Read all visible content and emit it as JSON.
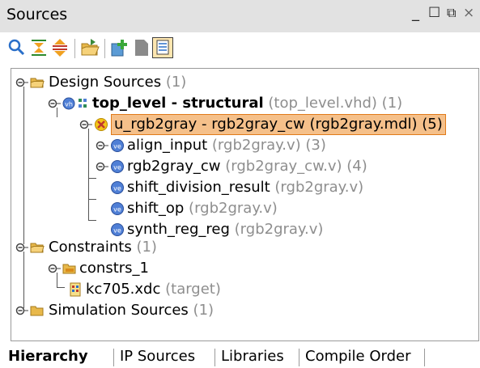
{
  "panel": {
    "title": "Sources"
  },
  "window_controls": {
    "minimize": "_",
    "maximize": "☐",
    "restore": "⧉",
    "close": "×"
  },
  "toolbar": {
    "buttons": [
      "search-icon",
      "collapse-all-icon",
      "expand-all-icon",
      "open-folder-icon",
      "add-sources-icon",
      "file-icon",
      "show-hierarchy-icon"
    ]
  },
  "tree": {
    "design_sources": {
      "label": "Design Sources",
      "count": "(1)"
    },
    "top_level": {
      "label": "top_level - structural",
      "file": "(top_level.vhd)",
      "count": "(1)"
    },
    "u_rgb2gray": {
      "label": "u_rgb2gray - rgb2gray_cw (rgb2gray.mdl) (5)"
    },
    "align_input": {
      "label": "align_input",
      "file": "(rgb2gray.v)",
      "count": "(3)"
    },
    "rgb2gray_cw": {
      "label": "rgb2gray_cw",
      "file": "(rgb2gray_cw.v)",
      "count": "(4)"
    },
    "shift_division_result": {
      "label": "shift_division_result",
      "file": "(rgb2gray.v)"
    },
    "shift_op": {
      "label": "shift_op",
      "file": "(rgb2gray.v)"
    },
    "synth_reg_reg": {
      "label": "synth_reg_reg",
      "file": "(rgb2gray.v)"
    },
    "constraints": {
      "label": "Constraints",
      "count": "(1)"
    },
    "constrs_1": {
      "label": "constrs_1"
    },
    "kc705": {
      "label": "kc705.xdc",
      "file": "(target)"
    },
    "simulation_sources": {
      "label": "Simulation Sources",
      "count": "(1)"
    }
  },
  "tabs": [
    "Hierarchy",
    "IP Sources",
    "Libraries",
    "Compile Order"
  ],
  "active_tab": "Hierarchy",
  "colors": {
    "highlight": "#f5c08a",
    "highlight_border": "#e07b1a",
    "folder": "#e8b84a",
    "verilog": "#4f7fd6"
  }
}
